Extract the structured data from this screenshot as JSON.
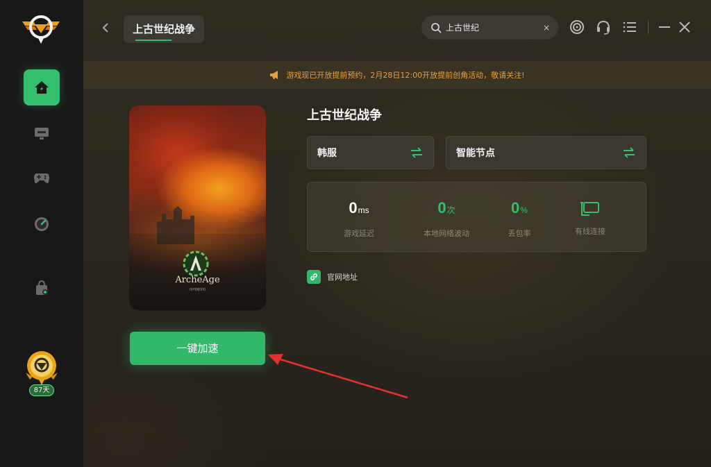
{
  "colors": {
    "accent_green": "#33c06c",
    "notice_orange": "#e6a13f",
    "sidebar_bg": "#181818"
  },
  "sidebar": {
    "logo_icon": "wings-shield-logo",
    "items": [
      {
        "icon": "home-icon",
        "active": true
      },
      {
        "icon": "monitor-icon",
        "active": false
      },
      {
        "icon": "gamepad-icon",
        "active": false
      },
      {
        "icon": "speedometer-icon",
        "active": false
      },
      {
        "icon": "shopping-bag-icon",
        "active": false
      }
    ],
    "member_badge": {
      "icon": "vip-badge-icon",
      "days_label": "87天"
    }
  },
  "header": {
    "tab_title": "上古世纪战争",
    "search": {
      "value": "上古世纪",
      "clear": "×"
    },
    "icons": [
      "swirl-icon",
      "headset-icon",
      "menu-icon",
      "minimize-icon",
      "close-icon"
    ]
  },
  "notice": {
    "icon": "megaphone-icon",
    "text": "游戏现已开放提前预约，2月28日12:00开放提前创角活动，敬请关注!"
  },
  "game": {
    "title": "上古世纪战争",
    "cover": {
      "brand": "ArcheAge",
      "brand_sub": "아키에이지"
    },
    "server": {
      "label": "韩服",
      "icon": "swap-icon"
    },
    "node": {
      "label": "智能节点",
      "icon": "swap-icon"
    },
    "stats": [
      {
        "value": "0",
        "unit": "ms",
        "caption": "游戏延迟",
        "color": "#ffffff"
      },
      {
        "value": "0",
        "unit": "次",
        "caption": "本地网络波动",
        "color": "#33c06c"
      },
      {
        "value": "0",
        "unit": "%",
        "caption": "丢包率",
        "color": "#33c06c"
      },
      {
        "value": "",
        "unit": "",
        "caption": "有线连接",
        "color": "#33c06c",
        "icon": "wired-connection-icon"
      }
    ],
    "official_link": {
      "icon": "link-icon",
      "label": "官网地址"
    },
    "accelerate_label": "一键加速"
  }
}
